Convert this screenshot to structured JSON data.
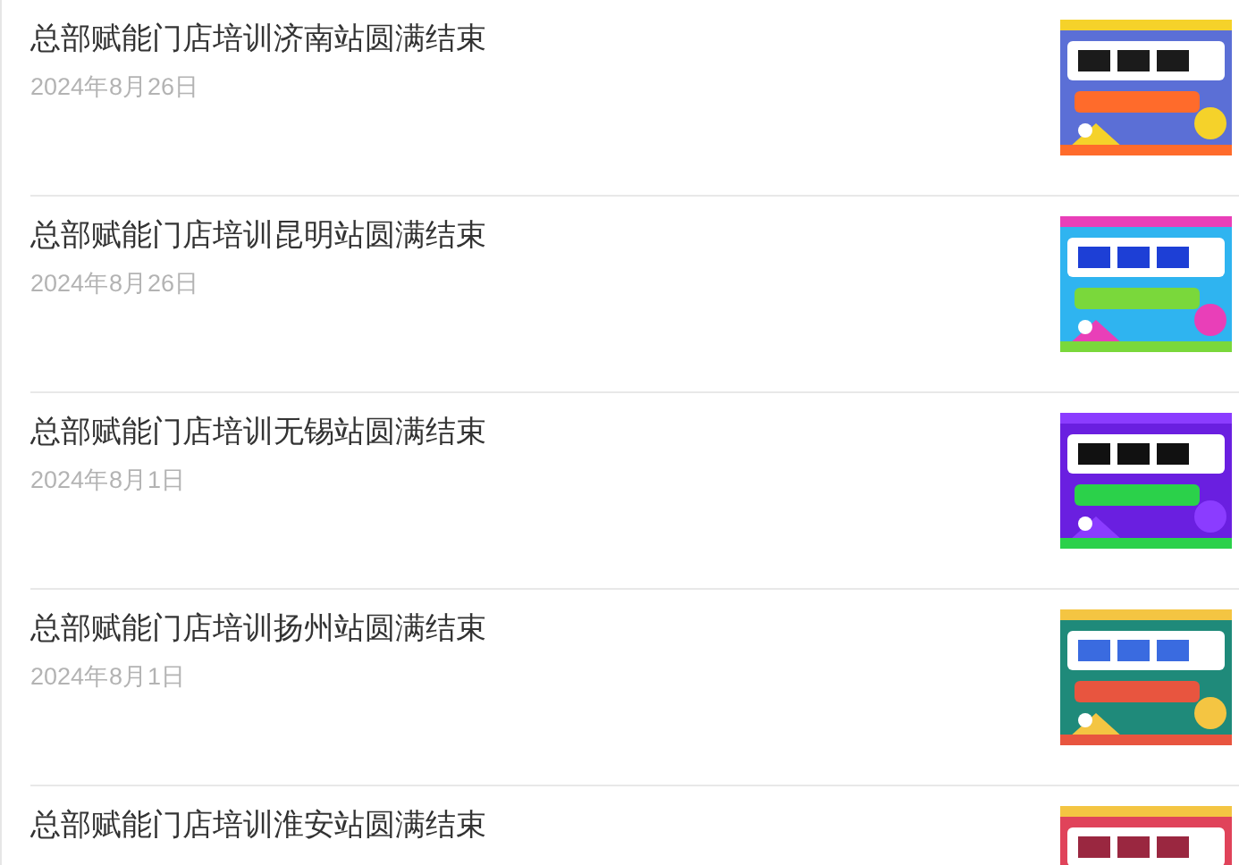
{
  "articles": [
    {
      "title": "总部赋能门店培训济南站圆满结束",
      "date": "2024年8月26日"
    },
    {
      "title": "总部赋能门店培训昆明站圆满结束",
      "date": "2024年8月26日"
    },
    {
      "title": "总部赋能门店培训无锡站圆满结束",
      "date": "2024年8月1日"
    },
    {
      "title": "总部赋能门店培训扬州站圆满结束",
      "date": "2024年8月1日"
    },
    {
      "title": "总部赋能门店培训淮安站圆满结束"
    }
  ]
}
